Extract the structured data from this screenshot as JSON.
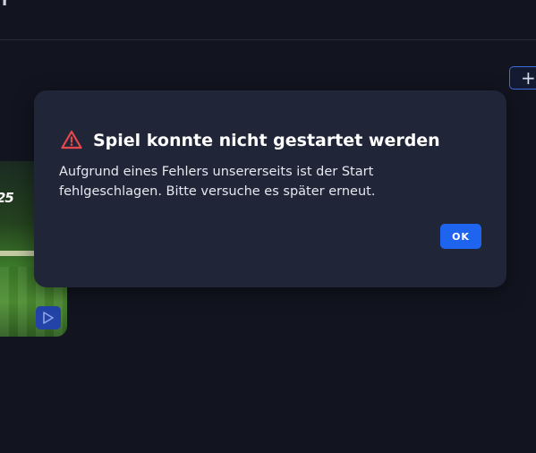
{
  "header": {
    "partial_glyph": "r"
  },
  "toolbar": {
    "add_label": "+"
  },
  "game_tile": {
    "logo_text": "25",
    "play_icon": "play-icon"
  },
  "dialog": {
    "icon": "warning-triangle-icon",
    "title": "Spiel konnte nicht gestartet werden",
    "message": "Aufgrund eines Fehlers unsererseits ist der Start fehlgeschlagen. Bitte versuche es später erneut.",
    "ok_label": "OK"
  },
  "colors": {
    "background": "#121420",
    "dialog_background": "#202538",
    "accent": "#1f64ee",
    "warning": "#e5484d"
  }
}
